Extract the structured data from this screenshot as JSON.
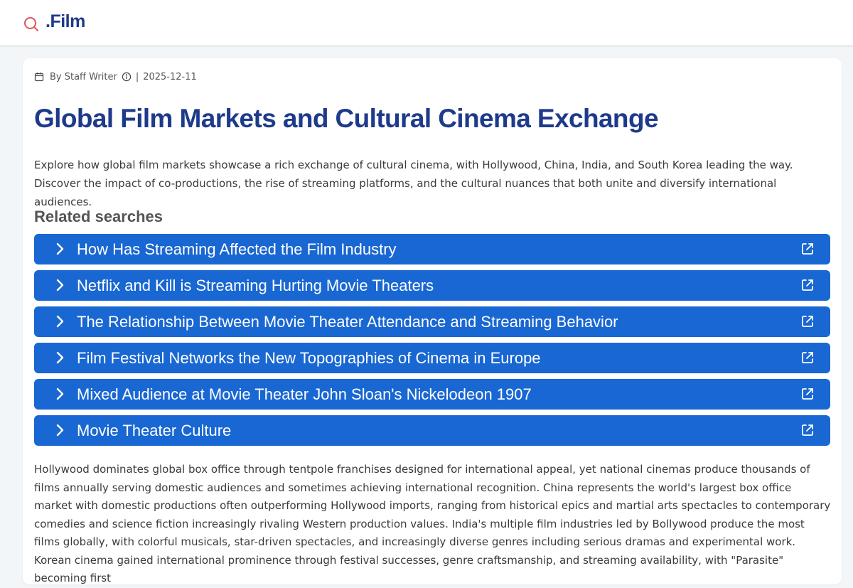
{
  "brand": {
    "name": ".Film",
    "icon": "search-icon",
    "icon_color": "#e0555a",
    "text_color": "#1e3a8a"
  },
  "article": {
    "author": "By Staff Writer",
    "separator": "|",
    "date": "2025-12-11",
    "title": "Global Film Markets and Cultural Cinema Exchange",
    "summary": "Explore how global film markets showcase a rich exchange of cultural cinema, with Hollywood, China, India, and South Korea leading the way. Discover the impact of co-productions, the rise of streaming platforms, and the cultural nuances that both unite and diversify international audiences.",
    "body": "Hollywood dominates global box office through tentpole franchises designed for international appeal, yet national cinemas produce thousands of films annually serving domestic audiences and sometimes achieving international recognition. China represents the world's largest box office market with domestic productions often outperforming Hollywood imports, ranging from historical epics and martial arts spectacles to contemporary comedies and science fiction increasingly rivaling Western production values. India's multiple film industries led by Bollywood produce the most films globally, with colorful musicals, star-driven spectacles, and increasingly diverse genres including serious dramas and experimental work. Korean cinema gained international prominence through festival successes, genre craftsmanship, and streaming availability, with \"Parasite\" becoming first"
  },
  "related": {
    "heading": "Related searches",
    "accent_color": "#1967d2",
    "items": [
      {
        "label": "How Has Streaming Affected the Film Industry"
      },
      {
        "label": "Netflix and Kill is Streaming Hurting Movie Theaters"
      },
      {
        "label": "The Relationship Between Movie Theater Attendance and Streaming Behavior"
      },
      {
        "label": "Film Festival Networks the New Topographies of Cinema in Europe"
      },
      {
        "label": "Mixed Audience at Movie Theater John Sloan's Nickelodeon 1907"
      },
      {
        "label": "Movie Theater Culture"
      }
    ]
  }
}
